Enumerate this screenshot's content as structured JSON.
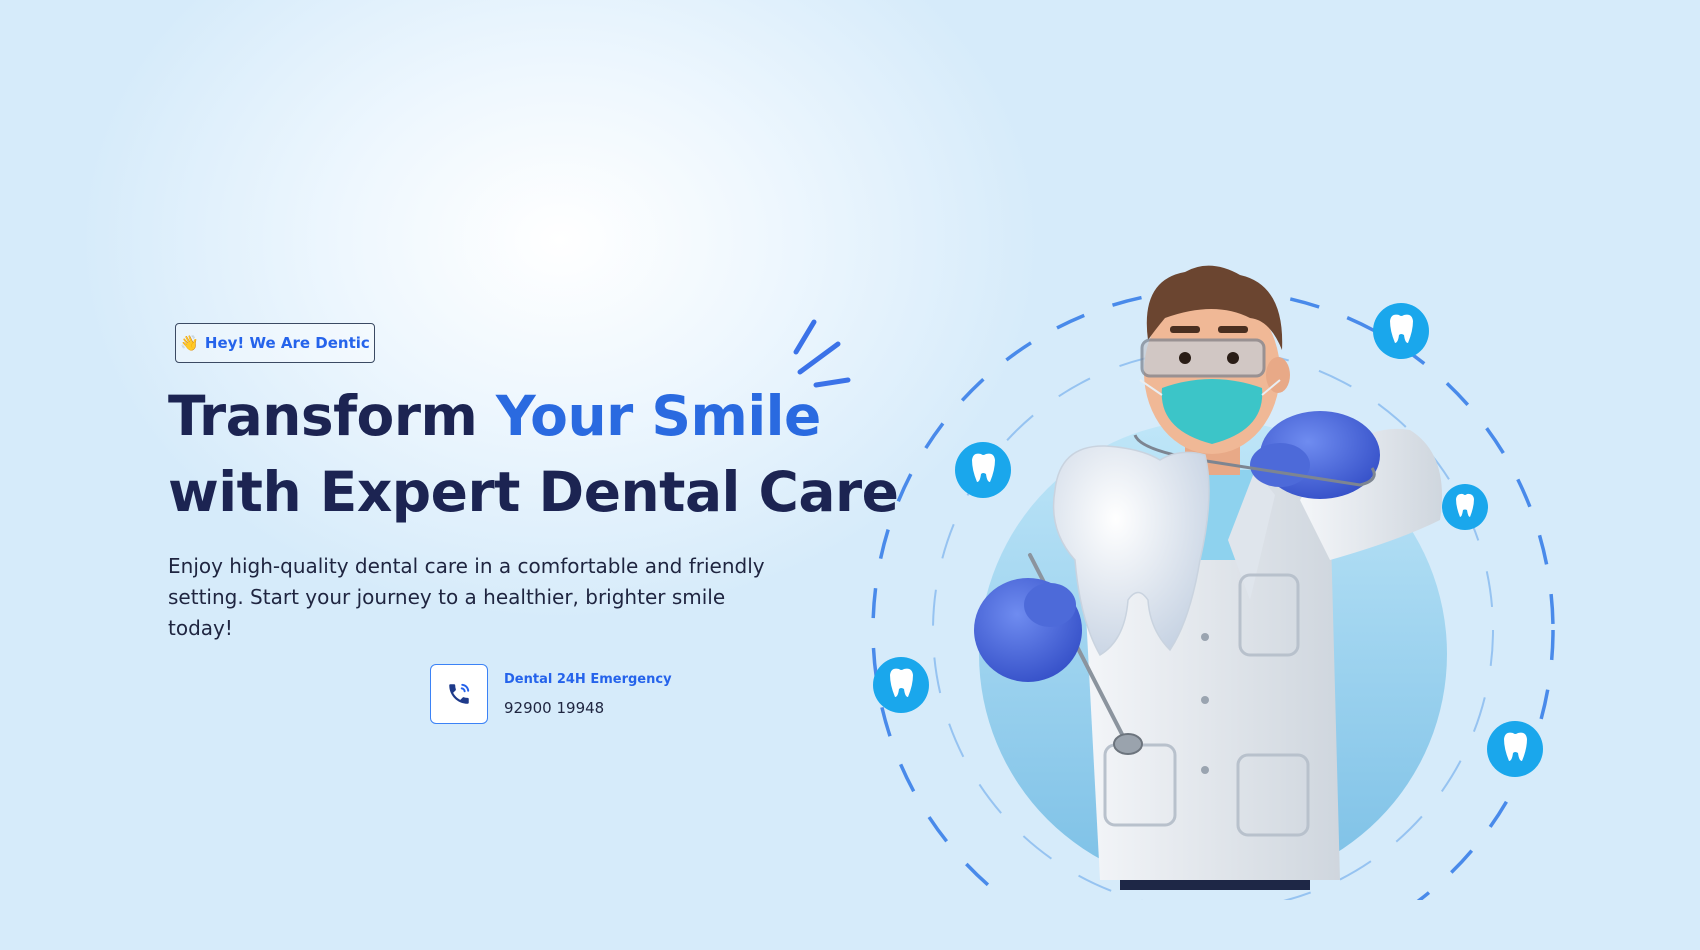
{
  "hero": {
    "badge_emoji": "👋",
    "badge_text": "Hey! We Are Dentic",
    "title_part1": "Transform ",
    "title_accent": "Your Smile",
    "title_line2": "with Expert Dental Care",
    "description": "Enjoy high-quality dental care in a comfortable and friendly setting. Start your journey to a healthier, brighter smile today!"
  },
  "emergency": {
    "label": "Dental 24H Emergency",
    "phone": "92900 19948",
    "icon": "phone-icon"
  },
  "illustration": {
    "subject": "dentist-character",
    "floating_icons": [
      "tooth-icon",
      "tooth-icon",
      "tooth-icon",
      "tooth-icon",
      "tooth-icon"
    ]
  },
  "colors": {
    "primary_blue": "#2a6ae0",
    "heading_navy": "#1c2452",
    "icon_badge": "#1aa7ec",
    "circle_light": "#a9d9f2"
  }
}
